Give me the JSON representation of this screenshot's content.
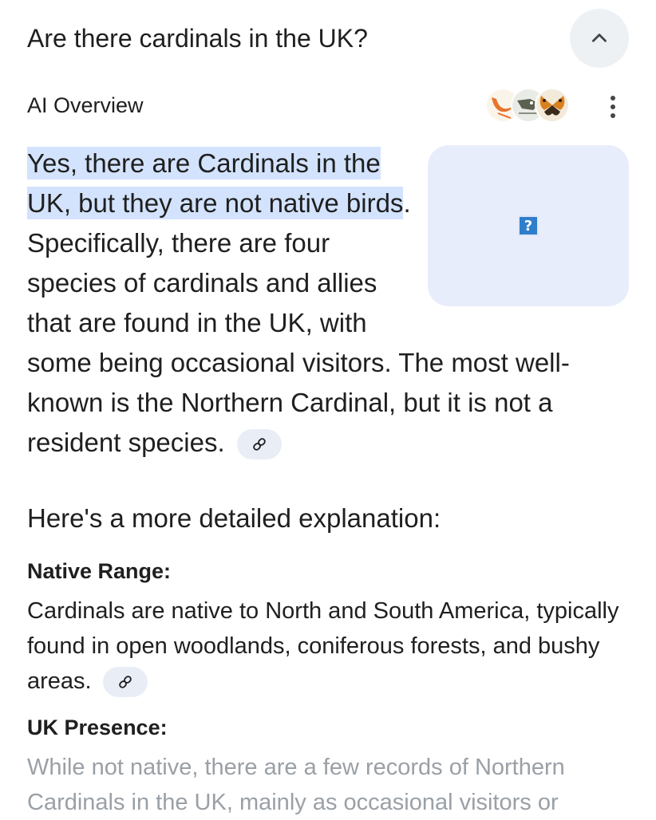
{
  "header": {
    "question": "Are there cardinals in the UK?",
    "collapse_icon": "chevron-up-icon"
  },
  "overview": {
    "label": "AI Overview",
    "source_icons": [
      "source-favicon-bird",
      "source-favicon-bird-logo",
      "source-favicon-butterfly"
    ],
    "more_icon": "more-vert-icon",
    "image_placeholder": "?"
  },
  "answer": {
    "highlight": "Yes, there are Cardinals in the UK, but they are not native birds",
    "rest": ". Specifically, there are four species of cardinals and allies that are found in the UK, with some being occasional visitors. The most well-known is the Northern Cardinal, but it is not a resident species."
  },
  "intro": "Here's a more detailed explanation:",
  "sections": [
    {
      "title": "Native Range:",
      "body": "Cardinals are native to North and South America, typically found in open woodlands, coniferous forests, and bushy areas."
    },
    {
      "title": "UK Presence:",
      "body": "While not native, there are a few records of Northern Cardinals in the UK, mainly as occasional visitors or"
    }
  ],
  "colors": {
    "highlight": "#d3e3fd",
    "image_card": "#e8edfb",
    "chip": "#e9eef6",
    "collapse_button": "#eef1f4"
  }
}
